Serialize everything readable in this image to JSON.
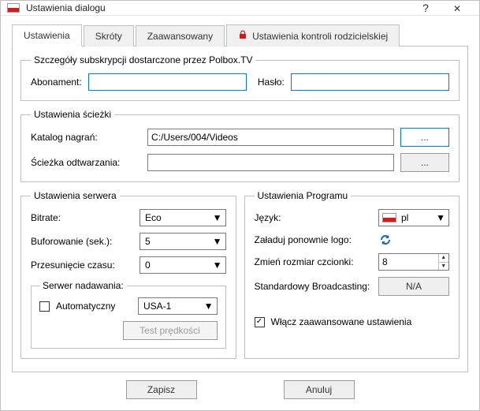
{
  "window": {
    "title": "Ustawienia dialogu"
  },
  "tabs": {
    "items": [
      {
        "label": "Ustawienia"
      },
      {
        "label": "Skróty"
      },
      {
        "label": "Zaawansowany"
      },
      {
        "label": "Ustawienia kontroli rodzicielskiej"
      }
    ],
    "active": 0
  },
  "subscription": {
    "legend": "Szczegóły subskrypcji dostarczone przez Polbox.TV",
    "abonament_label": "Abonament:",
    "abonament_value": "",
    "haslo_label": "Hasło:",
    "haslo_value": ""
  },
  "path": {
    "legend": "Ustawienia ścieżki",
    "recdir_label": "Katalog nagrań:",
    "recdir_value": "C:/Users/004/Videos",
    "playpath_label": "Ścieżka odtwarzania:",
    "playpath_value": "",
    "browse_label": "..."
  },
  "server": {
    "legend": "Ustawienia serwera",
    "bitrate_label": "Bitrate:",
    "bitrate_value": "Eco",
    "buffer_label": "Buforowanie (sek.):",
    "buffer_value": "5",
    "shift_label": "Przesunięcie czasu:",
    "shift_value": "0",
    "broadcast_legend": "Serwer nadawania:",
    "auto_label": "Automatyczny",
    "auto_checked": false,
    "broadcast_value": "USA-1",
    "speedtest_label": "Test prędkości"
  },
  "program": {
    "legend": "Ustawienia Programu",
    "lang_label": "Język:",
    "lang_value": "pl",
    "reloadlogo_label": "Załaduj ponownie logo:",
    "fontsize_label": "Zmień rozmiar czcionki:",
    "fontsize_value": "8",
    "stdbroadcast_label": "Standardowy Broadcasting:",
    "stdbroadcast_value": "N/A",
    "advanced_label": "Włącz zaawansowane ustawienia",
    "advanced_checked": true
  },
  "footer": {
    "save_label": "Zapisz",
    "cancel_label": "Anuluj"
  }
}
